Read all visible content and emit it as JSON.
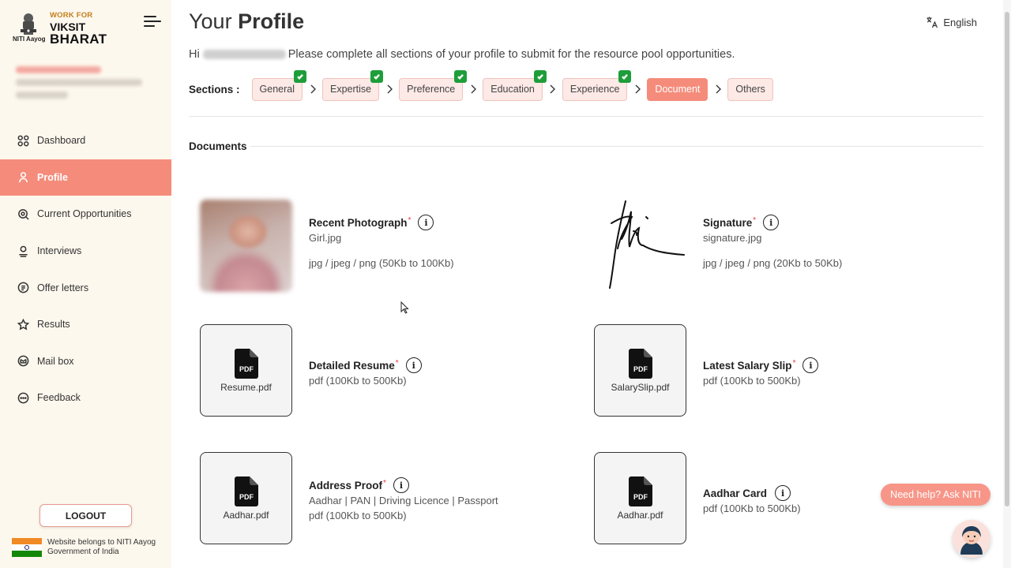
{
  "brand": {
    "emblem_caption": "NITI Aayog",
    "line1": "WORK FOR",
    "line2": "VIKSIT",
    "line3": "BHARAT"
  },
  "sidebar": {
    "items": [
      {
        "label": "Dashboard",
        "icon": "grid-icon",
        "active": false
      },
      {
        "label": "Profile",
        "icon": "user-icon",
        "active": true
      },
      {
        "label": "Current Opportunities",
        "icon": "search-icon",
        "active": false
      },
      {
        "label": "Interviews",
        "icon": "people-icon",
        "active": false
      },
      {
        "label": "Offer letters",
        "icon": "document-icon",
        "active": false
      },
      {
        "label": "Results",
        "icon": "star-icon",
        "active": false
      },
      {
        "label": "Mail box",
        "icon": "mail-icon",
        "active": false
      },
      {
        "label": "Feedback",
        "icon": "chat-icon",
        "active": false
      }
    ],
    "logout_label": "LOGOUT",
    "footer_text": "Website belongs to NITI Aayog Government of India"
  },
  "header": {
    "title_light": "Your",
    "title_bold": "Profile",
    "language": "English"
  },
  "greeting": {
    "prefix": "Hi",
    "message": "Please complete all sections of your profile to submit for the resource pool opportunities."
  },
  "sections": {
    "label": "Sections :",
    "steps": [
      {
        "label": "General",
        "completed": true,
        "active": false
      },
      {
        "label": "Expertise",
        "completed": true,
        "active": false
      },
      {
        "label": "Preference",
        "completed": true,
        "active": false
      },
      {
        "label": "Education",
        "completed": true,
        "active": false
      },
      {
        "label": "Experience",
        "completed": true,
        "active": false
      },
      {
        "label": "Document",
        "completed": false,
        "active": true
      },
      {
        "label": "Others",
        "completed": false,
        "active": false
      }
    ]
  },
  "documents": {
    "title": "Documents",
    "items": [
      {
        "name": "Recent Photograph",
        "required": "*",
        "file": "Girl.jpg",
        "hint": "jpg / jpeg / png (50Kb to 100Kb)"
      },
      {
        "name": "Signature",
        "required": "*",
        "file": "signature.jpg",
        "hint": "jpg / jpeg / png (20Kb to 50Kb)"
      },
      {
        "name": "Detailed Resume",
        "required": "*",
        "file": "Resume.pdf",
        "hint": "pdf (100Kb to 500Kb)"
      },
      {
        "name": "Latest Salary Slip",
        "required": "*",
        "file": "SalarySlip.pdf",
        "hint": "pdf (100Kb to 500Kb)"
      },
      {
        "name": "Address Proof",
        "required": "*",
        "file": "Aadhar.pdf",
        "hint": "Aadhar | PAN | Driving Licence | Passport",
        "hint2": "pdf (100Kb to 500Kb)"
      },
      {
        "name": "Aadhar Card",
        "required": "",
        "file": "Aadhar.pdf",
        "hint": "pdf (100Kb to 500Kb)"
      }
    ],
    "pdf_icon_label": "PDF",
    "info_glyph": "i"
  },
  "help": {
    "label": "Need help? Ask NITI"
  },
  "colors": {
    "accent": "#f58c7b",
    "accent_light": "#fde9e6",
    "sidebar_bg": "#fdf8ee",
    "success": "#1e9e3a"
  }
}
